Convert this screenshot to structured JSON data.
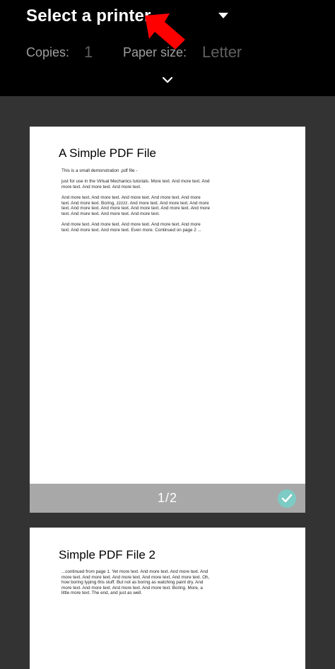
{
  "header": {
    "printer_title": "Select a printer",
    "copies_label": "Copies:",
    "copies_value": "1",
    "paper_size_label": "Paper size:",
    "paper_size_value": "Letter",
    "annotation_color": "#ff0000"
  },
  "icons": {
    "printer_dropdown": "caret-down-icon",
    "expand": "chevron-down-icon",
    "page_selected": "check-circle-icon"
  },
  "pages": [
    {
      "title": "A Simple PDF File",
      "paragraphs": [
        "This is a small demonstration .pdf file -",
        "just for use in the Virtual Mechanics tutorials. More text. And more text. And more text. And more text. And more text.",
        "And more text. And more text. And more text. And more text. And more text. And more text. Boring, zzzzz. And more text. And more text. And more text. And more text. And more text. And more text. And more text. And more text. And more text. And more text. And more text.",
        "And more text. And more text. And more text. And more text. And more text. And more text. And more text. Even more. Continued on page 2 ..."
      ],
      "page_label": "1/2",
      "selected": true
    },
    {
      "title": "Simple PDF File 2",
      "paragraphs": [
        "...continued from page 1. Yet more text. And more text. And more text. And more text. And more text. And more text. And more text. And more text. Oh, how boring typing this stuff. But not as boring as watching paint dry. And more text. And more text. And more text. And more text. Boring.  More, a little more text. The end, and just as well."
      ]
    }
  ],
  "colors": {
    "header_bg": "#000000",
    "preview_bg": "#333333",
    "footer_bg": "#a8a8a8",
    "check_accent": "#7ccbc4"
  }
}
